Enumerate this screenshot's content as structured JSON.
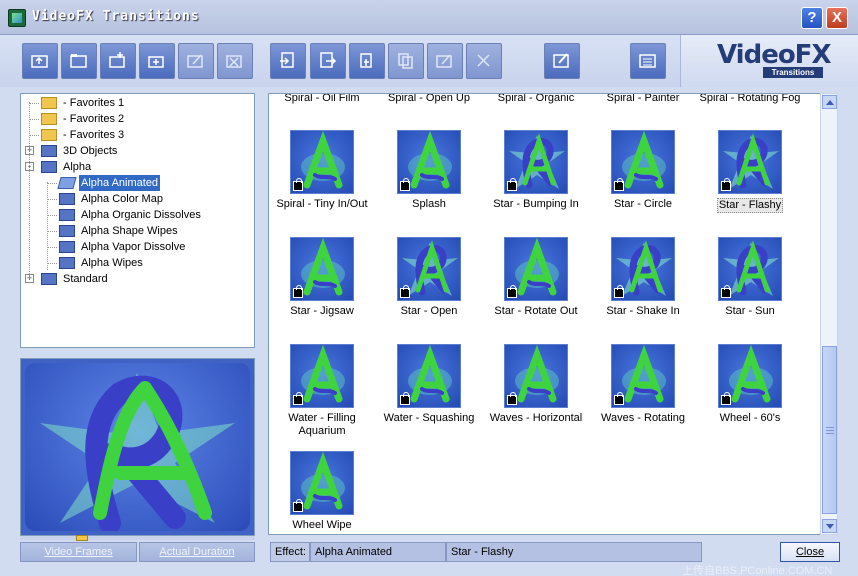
{
  "window": {
    "title": "VideoFX Transitions",
    "help_label": "?",
    "close_label": "X"
  },
  "logo": {
    "main": "VideoFX",
    "sub": "Transitions"
  },
  "tree": [
    {
      "label": "- Favorites 1",
      "folder": "yellow"
    },
    {
      "label": "- Favorites 2",
      "folder": "yellow"
    },
    {
      "label": "- Favorites 3",
      "folder": "yellow"
    },
    {
      "label": "3D Objects",
      "folder": "blue",
      "expander": "+"
    },
    {
      "label": "Alpha",
      "folder": "blue",
      "expander": "-"
    },
    {
      "label": "Alpha Animated",
      "folder": "open",
      "selected": true
    },
    {
      "label": "Alpha Color Map",
      "folder": "blue"
    },
    {
      "label": "Alpha Organic Dissolves",
      "folder": "blue"
    },
    {
      "label": "Alpha Shape Wipes",
      "folder": "blue"
    },
    {
      "label": "Alpha Vapor Dissolve",
      "folder": "blue"
    },
    {
      "label": "Alpha Wipes",
      "folder": "blue"
    },
    {
      "label": "Standard",
      "folder": "blue",
      "expander": "+"
    }
  ],
  "grid": {
    "top_row": [
      "Spiral - Oil Film",
      "Spiral - Open Up",
      "Spiral - Organic",
      "Spiral - Painter",
      "Spiral - Rotating Fog"
    ],
    "items": [
      {
        "label": "Spiral - Tiny In/Out",
        "letter": "A"
      },
      {
        "label": "Splash",
        "letter": "A"
      },
      {
        "label": "Star - Bumping In",
        "letter": "R"
      },
      {
        "label": "Star - Circle",
        "letter": "A"
      },
      {
        "label": "Star - Flashy",
        "letter": "R",
        "selected": true
      },
      {
        "label": "Star - Jigsaw",
        "letter": "A"
      },
      {
        "label": "Star - Open",
        "letter": "R"
      },
      {
        "label": "Star - Rotate Out",
        "letter": "A"
      },
      {
        "label": "Star - Shake In",
        "letter": "R"
      },
      {
        "label": "Star - Sun",
        "letter": "R"
      },
      {
        "label": "Water - Filling Aquarium",
        "letter": "A"
      },
      {
        "label": "Water - Squashing",
        "letter": "A"
      },
      {
        "label": "Waves - Horizontal",
        "letter": "A"
      },
      {
        "label": "Waves - Rotating",
        "letter": "A"
      },
      {
        "label": "Wheel - 60's",
        "letter": "A"
      },
      {
        "label": "Wheel Wipe",
        "letter": "A"
      }
    ]
  },
  "buttons": {
    "video_frames": "Video Frames",
    "actual_duration": "Actual Duration",
    "close": "Close"
  },
  "status": {
    "effect_label": "Effect:",
    "category": "Alpha Animated",
    "transition": "Star - Flashy"
  },
  "watermark": "上传自BBS.PConline.COM.CN",
  "colors": {
    "accent": "#316ac5",
    "thumb_bg": "#2f58c2",
    "letter_green": "#3fd43f",
    "letter_blue": "#3a3fc8"
  }
}
